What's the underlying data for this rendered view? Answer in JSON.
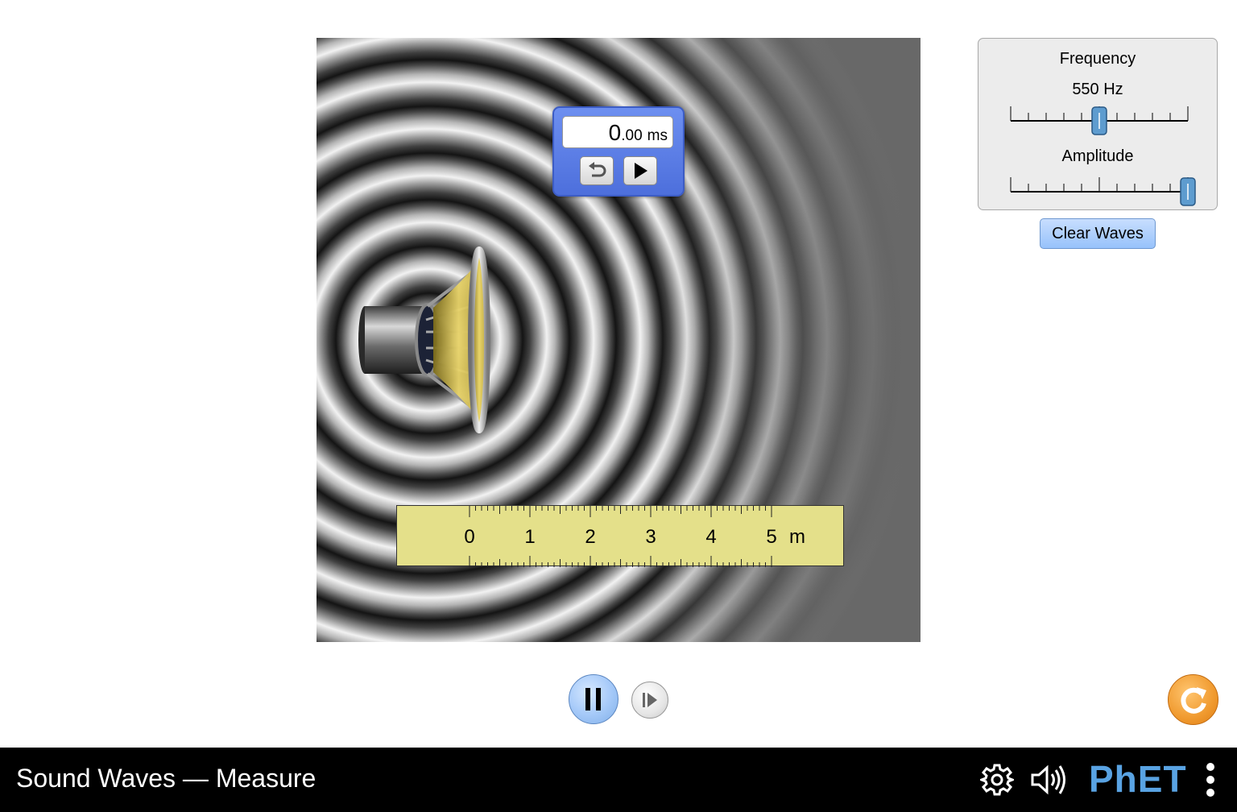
{
  "stopwatch": {
    "value_main": "0",
    "value_decimal": ".00",
    "unit": "ms"
  },
  "ruler": {
    "ticks": [
      "0",
      "1",
      "2",
      "3",
      "4",
      "5"
    ],
    "unit": "m"
  },
  "controls": {
    "frequency": {
      "label": "Frequency",
      "value_text": "550 Hz",
      "level": 0.5
    },
    "amplitude": {
      "label": "Amplitude",
      "level": 1.0
    },
    "clear_waves": "Clear Waves"
  },
  "playback": {
    "state": "playing"
  },
  "nav": {
    "title": "Sound Waves — Measure",
    "logo": "PhET"
  },
  "colors": {
    "accent_blue": "#97c2fb",
    "reset_orange": "#f09a2f",
    "ruler_yellow": "#e4e08a",
    "stopwatch_blue": "#5c7ee6"
  }
}
